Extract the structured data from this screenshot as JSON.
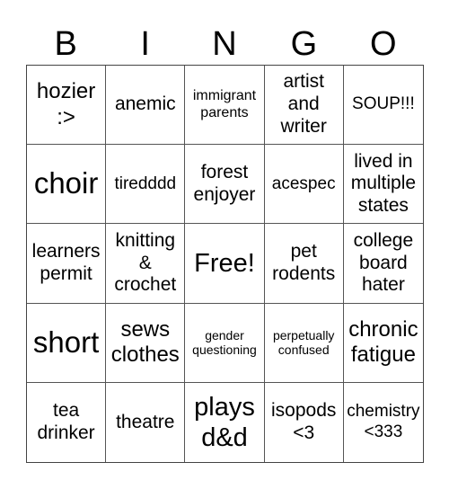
{
  "header": [
    "B",
    "I",
    "N",
    "G",
    "O"
  ],
  "cells": [
    {
      "text": "hozier\n:>",
      "size": "s24"
    },
    {
      "text": "anemic",
      "size": "s20"
    },
    {
      "text": "immigrant parents",
      "size": "s15"
    },
    {
      "text": "artist and writer",
      "size": "s20"
    },
    {
      "text": "SOUP!!!",
      "size": "s18"
    },
    {
      "text": "choir",
      "size": "s32"
    },
    {
      "text": "tiredddd",
      "size": "s18"
    },
    {
      "text": "forest enjoyer",
      "size": "s20"
    },
    {
      "text": "acespec",
      "size": "s18"
    },
    {
      "text": "lived in multiple states",
      "size": "s20"
    },
    {
      "text": "learners permit",
      "size": "s20"
    },
    {
      "text": "knitting & crochet",
      "size": "s20"
    },
    {
      "text": "Free!",
      "size": "s28"
    },
    {
      "text": "pet rodents",
      "size": "s20"
    },
    {
      "text": "college board hater",
      "size": "s20"
    },
    {
      "text": "short",
      "size": "s32"
    },
    {
      "text": "sews clothes",
      "size": "s24"
    },
    {
      "text": "gender questioning",
      "size": "s14"
    },
    {
      "text": "perpetually confused",
      "size": "s14"
    },
    {
      "text": "chronic fatigue",
      "size": "s24"
    },
    {
      "text": "tea drinker",
      "size": "s20"
    },
    {
      "text": "theatre",
      "size": "s20"
    },
    {
      "text": "plays d&d",
      "size": "s28"
    },
    {
      "text": "isopods <3",
      "size": "s20"
    },
    {
      "text": "chemistry <333",
      "size": "s18"
    }
  ]
}
